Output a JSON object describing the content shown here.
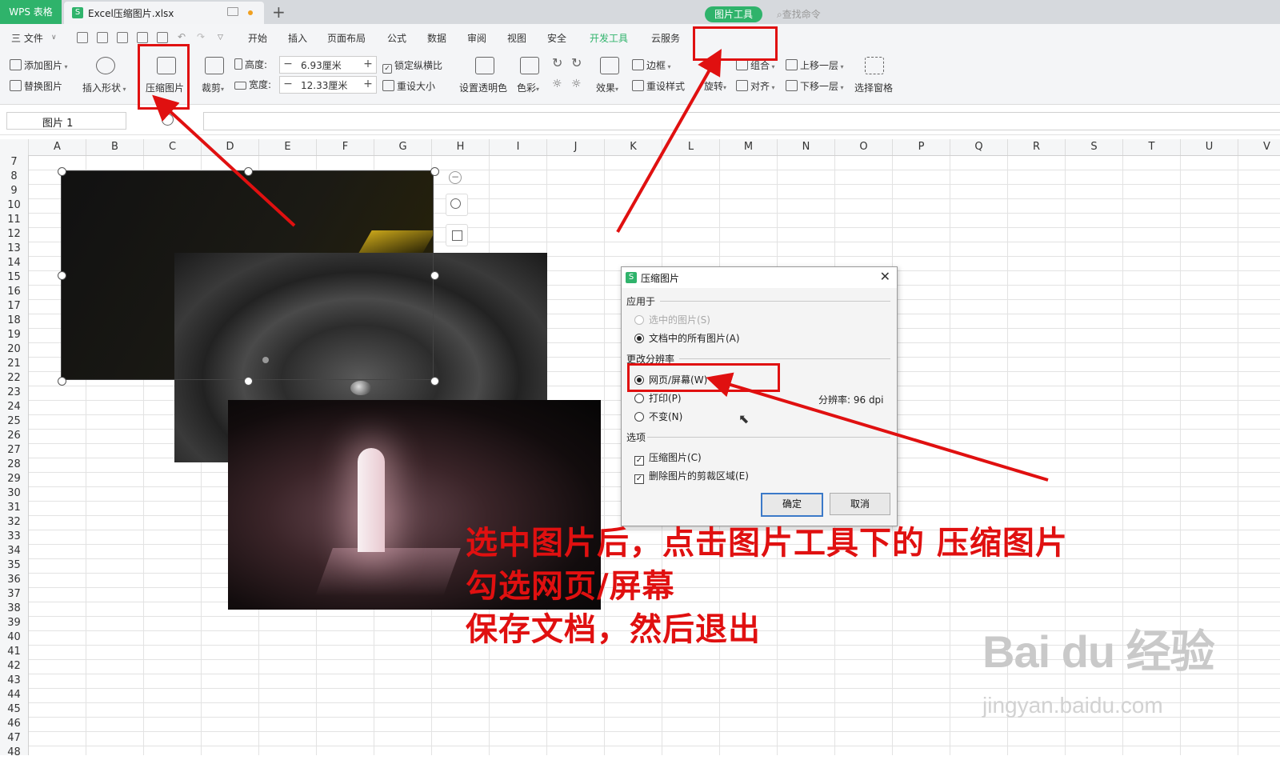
{
  "titlebar": {
    "app_tab": "WPS 表格",
    "file_tab": "Excel压缩图片.xlsx",
    "new_tab": "+"
  },
  "menu": {
    "file": "三 文件",
    "items": [
      "开始",
      "插入",
      "页面布局",
      "公式",
      "数据",
      "审阅",
      "视图",
      "安全",
      "开发工具",
      "云服务"
    ],
    "picture_tools": "图片工具",
    "search": "查找命令"
  },
  "ribbon": {
    "add_picture": "添加图片",
    "replace_picture": "替换图片",
    "insert_shape": "插入形状",
    "compress_picture": "压缩图片",
    "crop": "裁剪",
    "height_label": "高度:",
    "height_value": "6.93厘米",
    "width_label": "宽度:",
    "width_value": "12.33厘米",
    "lock_ratio": "锁定纵横比",
    "reset_size": "重设大小",
    "set_transparent": "设置透明色",
    "color": "色彩",
    "effects": "效果",
    "border": "边框",
    "reset_style": "重设样式",
    "rotate": "旋转",
    "group": "组合",
    "align": "对齐",
    "bring_forward": "上移一层",
    "send_backward": "下移一层",
    "selection_pane": "选择窗格"
  },
  "formula": {
    "name_box": "图片 1"
  },
  "sheet": {
    "columns": [
      "A",
      "B",
      "C",
      "D",
      "E",
      "F",
      "G",
      "H",
      "I",
      "J",
      "K",
      "L",
      "M",
      "N",
      "O",
      "P",
      "Q",
      "R",
      "S",
      "T",
      "U",
      "V"
    ],
    "rows": [
      "7",
      "8",
      "9",
      "10",
      "11",
      "12",
      "13",
      "14",
      "15",
      "16",
      "17",
      "18",
      "19",
      "20",
      "21",
      "22",
      "23",
      "24",
      "25",
      "26",
      "27",
      "28",
      "29",
      "30",
      "31",
      "32",
      "33",
      "34",
      "35",
      "36",
      "37",
      "38",
      "39",
      "40",
      "41",
      "42",
      "43",
      "44",
      "45",
      "46",
      "47",
      "48"
    ]
  },
  "dialog": {
    "title": "压缩图片",
    "apply_to": "应用于",
    "opt_selected": "选中的图片(S)",
    "opt_all": "文档中的所有图片(A)",
    "change_resolution": "更改分辨率",
    "opt_web": "网页/屏幕(W)",
    "opt_print": "打印(P)",
    "opt_nochange": "不变(N)",
    "resolution": "分辨率:  96 dpi",
    "options": "选项",
    "chk_compress": "压缩图片(C)",
    "chk_delete_crop": "删除图片的剪裁区域(E)",
    "ok": "确定",
    "cancel": "取消"
  },
  "annotation": {
    "line1": "选中图片后，点击图片工具下的 压缩图片",
    "line2": "勾选网页/屏幕",
    "line3": "保存文档，然后退出"
  },
  "watermark": {
    "text": "Bai du 经验",
    "url": "jingyan.baidu.com"
  },
  "colors": {
    "wps_green": "#2fb36b",
    "annotation_red": "#e01010",
    "dialog_focus": "#3b79c8"
  }
}
